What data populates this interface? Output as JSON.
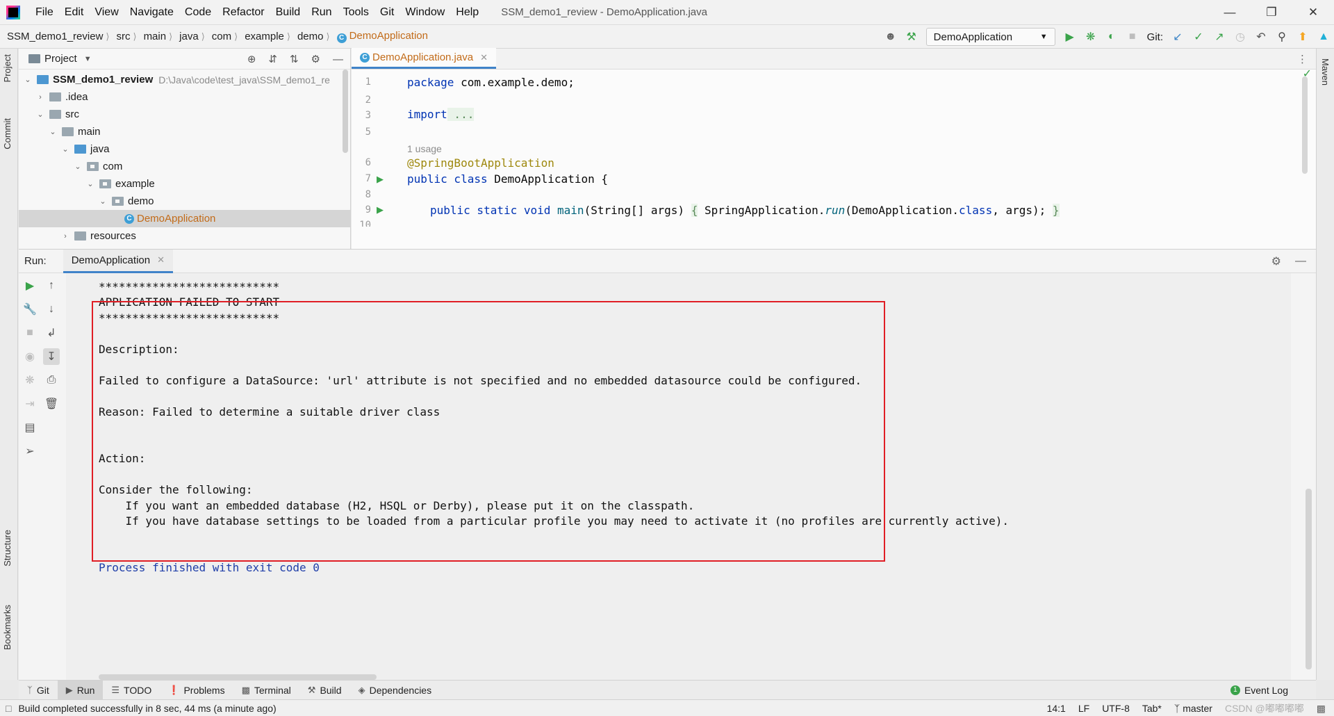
{
  "menubar": {
    "items": [
      "File",
      "Edit",
      "View",
      "Navigate",
      "Code",
      "Refactor",
      "Build",
      "Run",
      "Tools",
      "Git",
      "Window",
      "Help"
    ],
    "window_title": "SSM_demo1_review - DemoApplication.java"
  },
  "breadcrumb": [
    "SSM_demo1_review",
    "src",
    "main",
    "java",
    "com",
    "example",
    "demo",
    "DemoApplication"
  ],
  "toolbar": {
    "run_config": "DemoApplication",
    "git_label": "Git:"
  },
  "project_panel": {
    "title": "Project",
    "tree": [
      {
        "label": "SSM_demo1_review",
        "path": "D:\\Java\\code\\test_java\\SSM_demo1_re",
        "depth": 0,
        "expanded": true,
        "type": "module"
      },
      {
        "label": ".idea",
        "depth": 1,
        "expanded": false,
        "type": "folder"
      },
      {
        "label": "src",
        "depth": 1,
        "expanded": true,
        "type": "folder"
      },
      {
        "label": "main",
        "depth": 2,
        "expanded": true,
        "type": "folder"
      },
      {
        "label": "java",
        "depth": 3,
        "expanded": true,
        "type": "source"
      },
      {
        "label": "com",
        "depth": 4,
        "expanded": true,
        "type": "package"
      },
      {
        "label": "example",
        "depth": 5,
        "expanded": true,
        "type": "package"
      },
      {
        "label": "demo",
        "depth": 6,
        "expanded": true,
        "type": "package"
      },
      {
        "label": "DemoApplication",
        "depth": 7,
        "type": "class",
        "selected": true
      },
      {
        "label": "resources",
        "depth": 3,
        "expanded": false,
        "type": "folder"
      }
    ]
  },
  "editor": {
    "tab_label": "DemoApplication.java",
    "line_numbers": [
      "1",
      "2",
      "3",
      "5",
      "6",
      "7",
      "8",
      "9",
      "10"
    ],
    "usage_hint": "1 usage",
    "code": {
      "l1_kw": "package",
      "l1_rest": " com.example.demo;",
      "l3_kw": "import",
      "l3_fold": " ...",
      "l6": "@SpringBootApplication",
      "l7_kw": "public class",
      "l7_rest": " DemoApplication {",
      "l9_kw": "public static void",
      "l9_fn": " main",
      "l9_a": "(String[] args) ",
      "l9_b": "{",
      "l9_c": " SpringApplication.",
      "l9_run": "run",
      "l9_d": "(DemoApplication.",
      "l9_cls": "class",
      "l9_e": ", args); ",
      "l9_f": "}"
    }
  },
  "run_panel": {
    "label": "Run:",
    "tab": "DemoApplication",
    "console": [
      "***************************",
      "APPLICATION FAILED TO START",
      "***************************",
      "Description:",
      "Failed to configure a DataSource: 'url' attribute is not specified and no embedded datasource could be configured.",
      "Reason: Failed to determine a suitable driver class",
      "Action:",
      "Consider the following:",
      "    If you want an embedded database (H2, HSQL or Derby), please put it on the classpath.",
      "    If you have database settings to be loaded from a particular profile you may need to activate it (no profiles are currently active).",
      "Process finished with exit code 0"
    ]
  },
  "bottom_tabs": [
    "Git",
    "Run",
    "TODO",
    "Problems",
    "Terminal",
    "Build",
    "Dependencies"
  ],
  "event_log": "Event Log",
  "status": {
    "message": "Build completed successfully in 8 sec, 44 ms (a minute ago)",
    "position": "14:1",
    "line_sep": "LF",
    "encoding": "UTF-8",
    "indent": "Tab*",
    "branch": "master",
    "watermark": "CSDN @嘟嘟嘟嘟"
  },
  "side_labels": {
    "project": "Project",
    "commit": "Commit",
    "structure": "Structure",
    "bookmarks": "Bookmarks",
    "maven": "Maven"
  },
  "colors": {
    "accent": "#4083c9",
    "error_box": "#e01e25",
    "active_file": "#c26b19",
    "run_green": "#3aa34a"
  }
}
